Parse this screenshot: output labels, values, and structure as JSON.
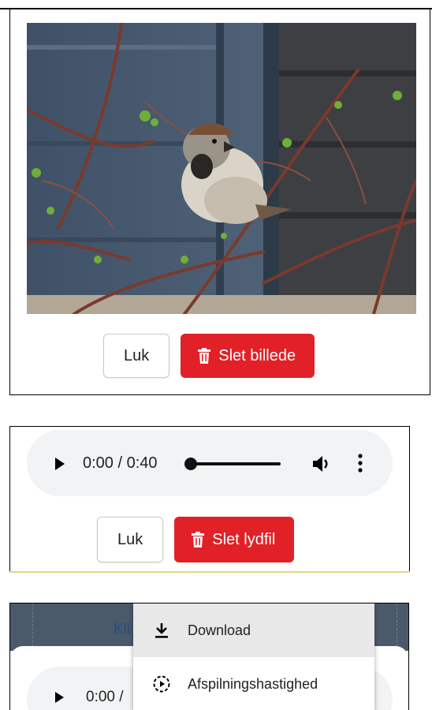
{
  "image_dialog": {
    "photo_icon": "sparrow-photo",
    "close_label": "Luk",
    "delete_label": "Slet billede",
    "delete_icon": "trash-icon"
  },
  "audio_dialog": {
    "time": "0:00 / 0:40",
    "progress": 0.0,
    "close_label": "Luk",
    "delete_label": "Slet lydfil"
  },
  "menu_overlay": {
    "background_partial": "Kli",
    "player_time_partial": "0:00 /",
    "items": [
      {
        "label": "Download",
        "icon": "download-icon"
      },
      {
        "label": "Afspilningshastighed",
        "icon": "playback-speed-icon"
      }
    ]
  },
  "colors": {
    "delete": "#e12127",
    "pill": "#f1f3f4",
    "menu_hover": "#e8e8e8"
  }
}
